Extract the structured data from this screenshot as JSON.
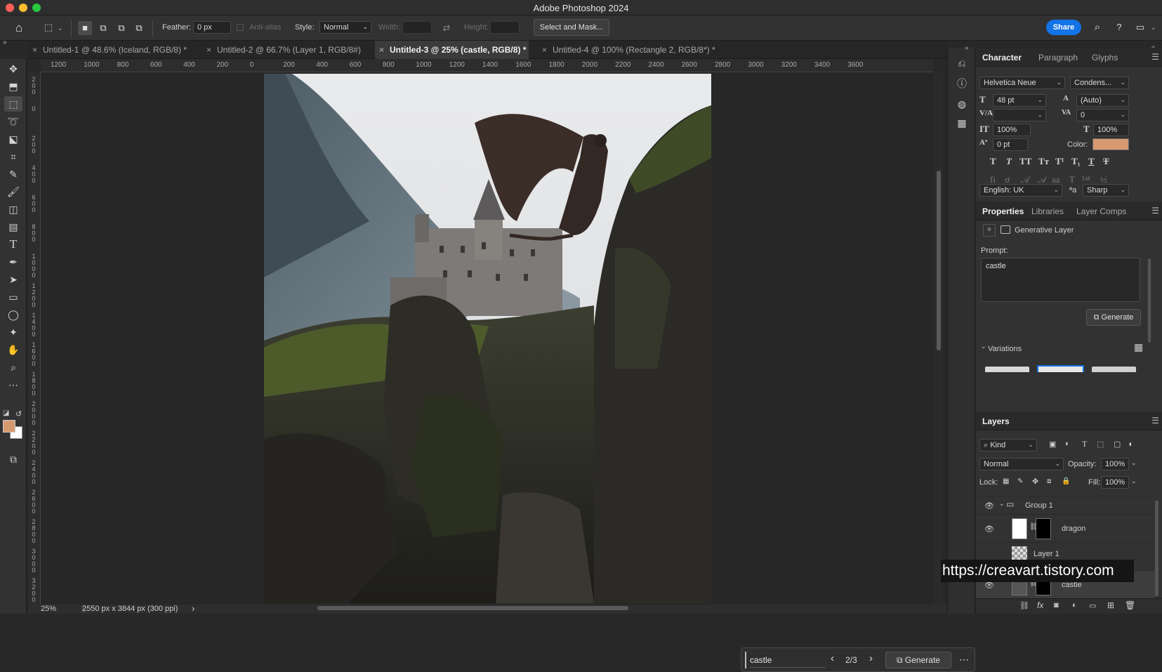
{
  "app": {
    "title": "Adobe Photoshop 2024"
  },
  "options_bar": {
    "feather_label": "Feather:",
    "feather_value": "0 px",
    "anti_alias_label": "Anti-alias",
    "style_label": "Style:",
    "style_value": "Normal",
    "width_label": "Width:",
    "height_label": "Height:",
    "select_mask_label": "Select and Mask...",
    "share_label": "Share"
  },
  "tabs": [
    {
      "label": "Untitled-1 @ 48.6% (Iceland, RGB/8) *"
    },
    {
      "label": "Untitled-2 @ 66.7% (Layer 1, RGB/8#)"
    },
    {
      "label": "Untitled-3 @ 25% (castle, RGB/8) *"
    },
    {
      "label": "Untitled-4 @ 100% (Rectangle 2, RGB/8*) *"
    }
  ],
  "ruler_top": [
    "1200",
    "1000",
    "800",
    "600",
    "400",
    "200",
    "0",
    "200",
    "400",
    "600",
    "800",
    "1000",
    "1200",
    "1400",
    "1600",
    "1800",
    "2000",
    "2200",
    "2400",
    "2600",
    "2800",
    "3000",
    "3200",
    "3400",
    "3600"
  ],
  "ruler_left": [
    "200",
    "0",
    "200",
    "400",
    "600",
    "800",
    "1000",
    "1200",
    "1400",
    "1600",
    "1800",
    "2000",
    "2200",
    "2400",
    "2600",
    "2800",
    "3000",
    "3200"
  ],
  "status": {
    "zoom": "25%",
    "doc_info": "2550 px x 3844 px (300 ppi)",
    "arrow": "›"
  },
  "gen_bar": {
    "prompt": "castle",
    "counter": "2/3",
    "generate_label": "Generate"
  },
  "character": {
    "tabs": [
      "Character",
      "Paragraph",
      "Glyphs"
    ],
    "font_family": "Helvetica Neue",
    "font_style": "Condens...",
    "font_size": "48 pt",
    "leading": "(Auto)",
    "kerning": "",
    "tracking": "0",
    "vertical_scale": "100%",
    "horizontal_scale": "100%",
    "baseline_shift": "0 pt",
    "color_label": "Color:",
    "language": "English: UK",
    "antialias": "Sharp",
    "aa_label": "ªa",
    "color_hex": "#d79a70"
  },
  "properties": {
    "tabs": [
      "Properties",
      "Libraries",
      "Layer Comps"
    ],
    "layer_type": "Generative Layer",
    "prompt_label": "Prompt:",
    "prompt_value": "castle",
    "generate_label": "Generate",
    "variations_label": "Variations"
  },
  "layers": {
    "title": "Layers",
    "filter_kind": "Kind",
    "blend_mode": "Normal",
    "opacity_label": "Opacity:",
    "opacity_value": "100%",
    "lock_label": "Lock:",
    "fill_label": "Fill:",
    "fill_value": "100%",
    "items": [
      {
        "name": "Group 1"
      },
      {
        "name": "dragon"
      },
      {
        "name": "Layer 1"
      },
      {
        "name": "castle"
      }
    ]
  },
  "watermark": "https://creavart.tistory.com",
  "colors": {
    "foreground": "#d79a70",
    "accent": "#1473e6"
  }
}
